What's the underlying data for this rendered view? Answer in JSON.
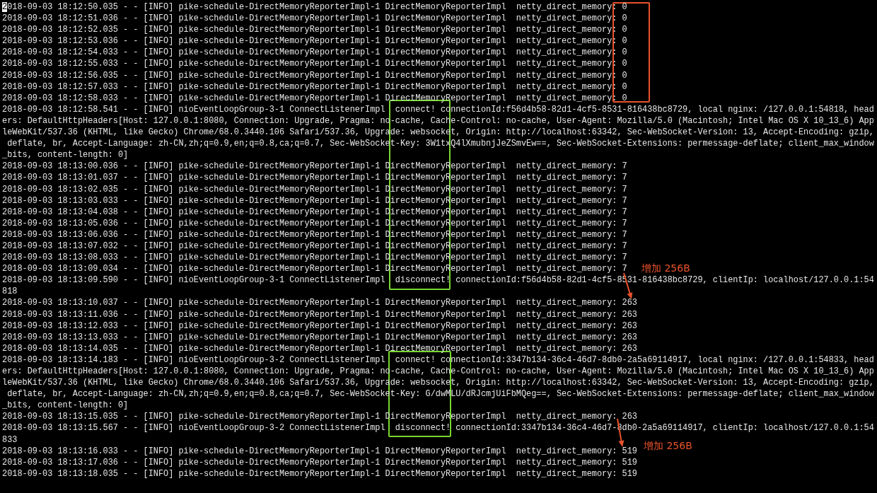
{
  "terminal": {
    "cursor": true,
    "lines": [
      {
        "text": "2018-09-03 18:12:50.035 - - [INFO] pike-schedule-DirectMemoryReporterImpl-1 DirectMemoryReporterImpl  netty_direct_memory: 0"
      },
      {
        "text": "2018-09-03 18:12:51.036 - - [INFO] pike-schedule-DirectMemoryReporterImpl-1 DirectMemoryReporterImpl  netty_direct_memory: 0"
      },
      {
        "text": "2018-09-03 18:12:52.035 - - [INFO] pike-schedule-DirectMemoryReporterImpl-1 DirectMemoryReporterImpl  netty_direct_memory: 0"
      },
      {
        "text": "2018-09-03 18:12:53.036 - - [INFO] pike-schedule-DirectMemoryReporterImpl-1 DirectMemoryReporterImpl  netty_direct_memory: 0"
      },
      {
        "text": "2018-09-03 18:12:54.033 - - [INFO] pike-schedule-DirectMemoryReporterImpl-1 DirectMemoryReporterImpl  netty_direct_memory: 0"
      },
      {
        "text": "2018-09-03 18:12:55.033 - - [INFO] pike-schedule-DirectMemoryReporterImpl-1 DirectMemoryReporterImpl  netty_direct_memory: 0"
      },
      {
        "text": "2018-09-03 18:12:56.035 - - [INFO] pike-schedule-DirectMemoryReporterImpl-1 DirectMemoryReporterImpl  netty_direct_memory: 0"
      },
      {
        "text": "2018-09-03 18:12:57.033 - - [INFO] pike-schedule-DirectMemoryReporterImpl-1 DirectMemoryReporterImpl  netty_direct_memory: 0"
      },
      {
        "text": "2018-09-03 18:12:58.033 - - [INFO] pike-schedule-DirectMemoryReporterImpl-1 DirectMemoryReporterImpl  netty_direct_memory: 0"
      },
      {
        "text": "2018-09-03 18:12:58.541 - - [INFO] nioEventLoopGroup-3-1 ConnectListenerImpl  connect! connectionId:f56d4b58-82d1-4cf5-8531-816438bc8729, local nginx: /127.0.0.1:54818, head"
      },
      {
        "text": "ers: DefaultHttpHeaders[Host: 127.0.0.1:8080, Connection: Upgrade, Pragma: no-cache, Cache-Control: no-cache, User-Agent: Mozilla/5.0 (Macintosh; Intel Mac OS X 10_13_6) App"
      },
      {
        "text": "leWebKit/537.36 (KHTML, like Gecko) Chrome/68.0.3440.106 Safari/537.36, Upgrade: websocket, Origin: http://localhost:63342, Sec-WebSocket-Version: 13, Accept-Encoding: gzip,"
      },
      {
        "text": " deflate, br, Accept-Language: zh-CN,zh;q=0.9,en;q=0.8,ca;q=0.7, Sec-WebSocket-Key: 3W1txQ4lXmubnjJeZSmvEw==, Sec-WebSocket-Extensions: permessage-deflate; client_max_window"
      },
      {
        "text": "_bits, content-length: 0]"
      },
      {
        "text": "2018-09-03 18:13:00.036 - - [INFO] pike-schedule-DirectMemoryReporterImpl-1 DirectMemoryReporterImpl  netty_direct_memory: 7"
      },
      {
        "text": "2018-09-03 18:13:01.037 - - [INFO] pike-schedule-DirectMemoryReporterImpl-1 DirectMemoryReporterImpl  netty_direct_memory: 7"
      },
      {
        "text": "2018-09-03 18:13:02.035 - - [INFO] pike-schedule-DirectMemoryReporterImpl-1 DirectMemoryReporterImpl  netty_direct_memory: 7"
      },
      {
        "text": "2018-09-03 18:13:03.033 - - [INFO] pike-schedule-DirectMemoryReporterImpl-1 DirectMemoryReporterImpl  netty_direct_memory: 7"
      },
      {
        "text": "2018-09-03 18:13:04.038 - - [INFO] pike-schedule-DirectMemoryReporterImpl-1 DirectMemoryReporterImpl  netty_direct_memory: 7"
      },
      {
        "text": "2018-09-03 18:13:05.036 - - [INFO] pike-schedule-DirectMemoryReporterImpl-1 DirectMemoryReporterImpl  netty_direct_memory: 7"
      },
      {
        "text": "2018-09-03 18:13:06.036 - - [INFO] pike-schedule-DirectMemoryReporterImpl-1 DirectMemoryReporterImpl  netty_direct_memory: 7"
      },
      {
        "text": "2018-09-03 18:13:07.032 - - [INFO] pike-schedule-DirectMemoryReporterImpl-1 DirectMemoryReporterImpl  netty_direct_memory: 7"
      },
      {
        "text": "2018-09-03 18:13:08.033 - - [INFO] pike-schedule-DirectMemoryReporterImpl-1 DirectMemoryReporterImpl  netty_direct_memory: 7"
      },
      {
        "text": "2018-09-03 18:13:09.034 - - [INFO] pike-schedule-DirectMemoryReporterImpl-1 DirectMemoryReporterImpl  netty_direct_memory: 7"
      },
      {
        "text": "2018-09-03 18:13:09.590 - - [INFO] nioEventLoopGroup-3-1 ConnectListenerImpl  disconnect! connectionId:f56d4b58-82d1-4cf5-8531-816438bc8729, clientIp: localhost/127.0.0.1:54"
      },
      {
        "text": "818"
      },
      {
        "text": "2018-09-03 18:13:10.037 - - [INFO] pike-schedule-DirectMemoryReporterImpl-1 DirectMemoryReporterImpl  netty_direct_memory: 263"
      },
      {
        "text": "2018-09-03 18:13:11.036 - - [INFO] pike-schedule-DirectMemoryReporterImpl-1 DirectMemoryReporterImpl  netty_direct_memory: 263"
      },
      {
        "text": "2018-09-03 18:13:12.033 - - [INFO] pike-schedule-DirectMemoryReporterImpl-1 DirectMemoryReporterImpl  netty_direct_memory: 263"
      },
      {
        "text": "2018-09-03 18:13:13.033 - - [INFO] pike-schedule-DirectMemoryReporterImpl-1 DirectMemoryReporterImpl  netty_direct_memory: 263"
      },
      {
        "text": "2018-09-03 18:13:14.035 - - [INFO] pike-schedule-DirectMemoryReporterImpl-1 DirectMemoryReporterImpl  netty_direct_memory: 263"
      },
      {
        "text": "2018-09-03 18:13:14.183 - - [INFO] nioEventLoopGroup-3-2 ConnectListenerImpl  connect! connectionId:3347b134-36c4-46d7-8db0-2a5a69114917, local nginx: /127.0.0.1:54833, head"
      },
      {
        "text": "ers: DefaultHttpHeaders[Host: 127.0.0.1:8080, Connection: Upgrade, Pragma: no-cache, Cache-Control: no-cache, User-Agent: Mozilla/5.0 (Macintosh; Intel Mac OS X 10_13_6) App"
      },
      {
        "text": "leWebKit/537.36 (KHTML, like Gecko) Chrome/68.0.3440.106 Safari/537.36, Upgrade: websocket, Origin: http://localhost:63342, Sec-WebSocket-Version: 13, Accept-Encoding: gzip,"
      },
      {
        "text": " deflate, br, Accept-Language: zh-CN,zh;q=0.9,en;q=0.8,ca;q=0.7, Sec-WebSocket-Key: G/dwMLU/dRJcmjUiFbMQeg==, Sec-WebSocket-Extensions: permessage-deflate; client_max_window"
      },
      {
        "text": "_bits, content-length: 0]"
      },
      {
        "text": "2018-09-03 18:13:15.035 - - [INFO] pike-schedule-DirectMemoryReporterImpl-1 DirectMemoryReporterImpl  netty_direct_memory: 263"
      },
      {
        "text": "2018-09-03 18:13:15.567 - - [INFO] nioEventLoopGroup-3-2 ConnectListenerImpl  disconnect! connectionId:3347b134-36c4-46d7-8db0-2a5a69114917, clientIp: localhost/127.0.0.1:54"
      },
      {
        "text": "833"
      },
      {
        "text": "2018-09-03 18:13:16.033 - - [INFO] pike-schedule-DirectMemoryReporterImpl-1 DirectMemoryReporterImpl  netty_direct_memory: 519"
      },
      {
        "text": "2018-09-03 18:13:17.036 - - [INFO] pike-schedule-DirectMemoryReporterImpl-1 DirectMemoryReporterImpl  netty_direct_memory: 519"
      },
      {
        "text": "2018-09-03 18:13:18.035 - - [INFO] pike-schedule-DirectMemoryReporterImpl-1 DirectMemoryReporterImpl  netty_direct_memory: 519"
      }
    ]
  },
  "annotations": [
    {
      "kind": "box",
      "color": "#e8522c"
    },
    {
      "kind": "box",
      "color": "#78d630"
    },
    {
      "kind": "box",
      "color": "#78d630"
    },
    {
      "kind": "arrow",
      "color": "#e8522c",
      "label": "增加 256B"
    },
    {
      "kind": "arrow",
      "color": "#e8522c",
      "label": "增加 256B"
    }
  ]
}
